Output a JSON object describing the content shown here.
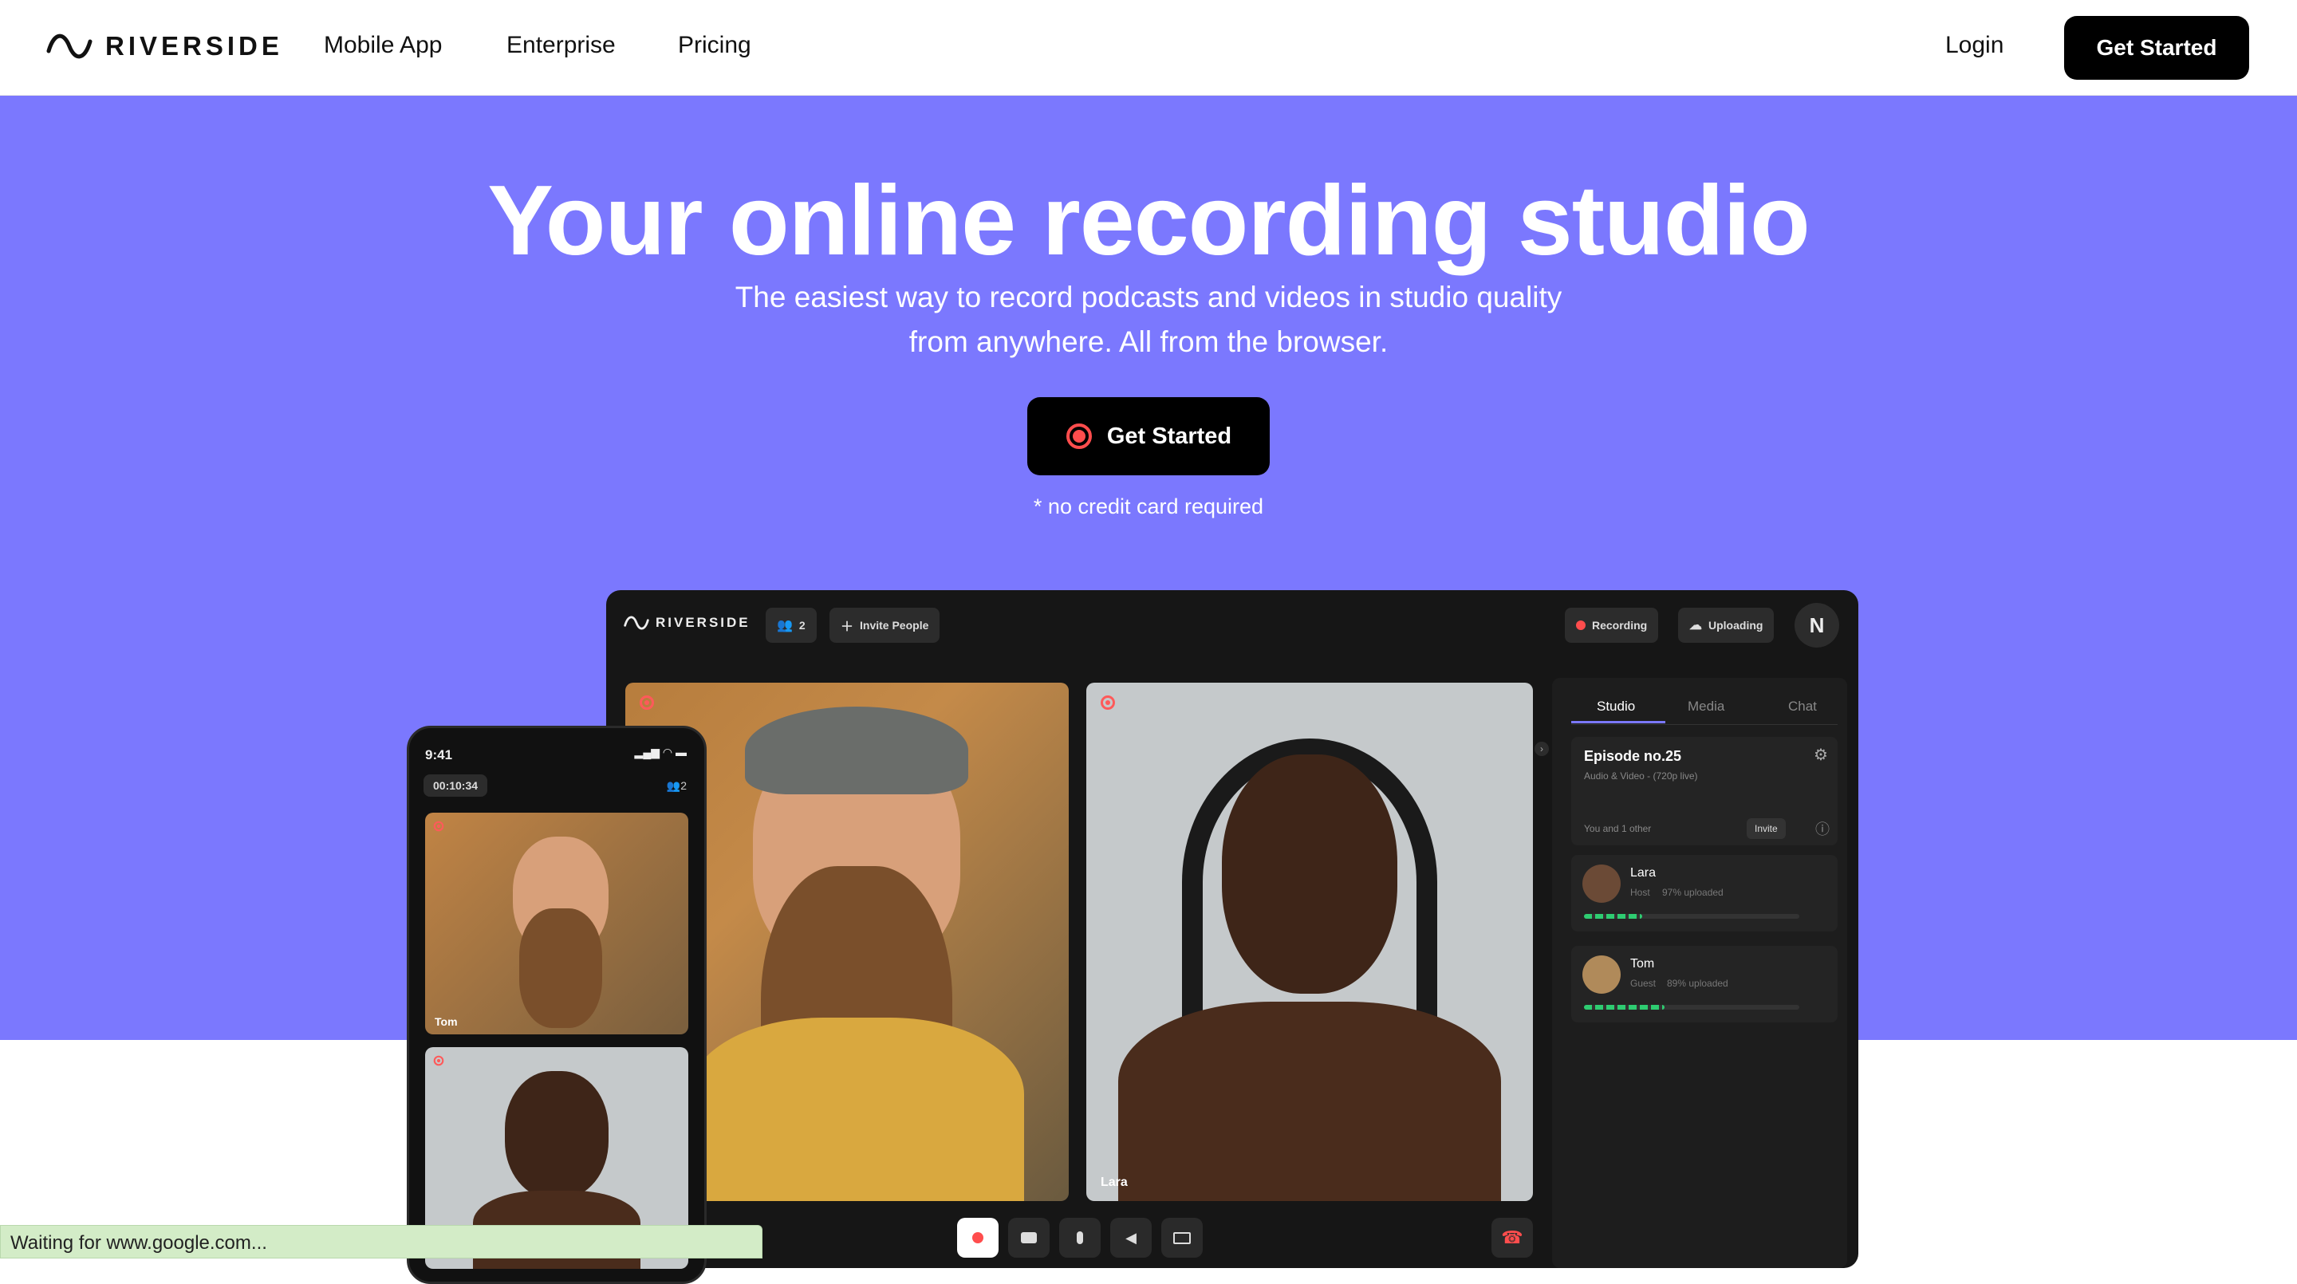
{
  "nav": {
    "brand": "RIVERSIDE",
    "links": [
      "Mobile App",
      "Enterprise",
      "Pricing"
    ],
    "login": "Login",
    "cta": "Get Started"
  },
  "hero": {
    "title": "Your online recording studio",
    "subtitle": "The easiest way to record podcasts and videos in studio quality from anywhere. All from the browser.",
    "cta": "Get Started",
    "note": "* no credit card required"
  },
  "app": {
    "brand": "RIVERSIDE",
    "people_count": "2",
    "invite": "Invite People",
    "recording": "Recording",
    "uploading": "Uploading",
    "avatar": "N",
    "tabs": [
      "Studio",
      "Media",
      "Chat"
    ],
    "episode": {
      "title": "Episode no.25",
      "meta": "Audio & Video - (720p live)",
      "participants": "You and 1 other",
      "invite": "Invite"
    },
    "people": [
      {
        "name": "Lara",
        "role": "Host",
        "status": "97% uploaded",
        "progress": 0.97
      },
      {
        "name": "Tom",
        "role": "Guest",
        "status": "89% uploaded",
        "progress": 0.89
      }
    ],
    "main_tile_label": "Lara"
  },
  "phone": {
    "time": "9:41",
    "timer": "00:10:34",
    "people_count": "2",
    "tile_label": "Tom"
  },
  "browser_status": "Waiting for www.google.com...",
  "colors": {
    "hero_bg": "#7b78fe",
    "record_red": "#ff4d4d",
    "status_bar_bg": "#d3ecc7"
  }
}
